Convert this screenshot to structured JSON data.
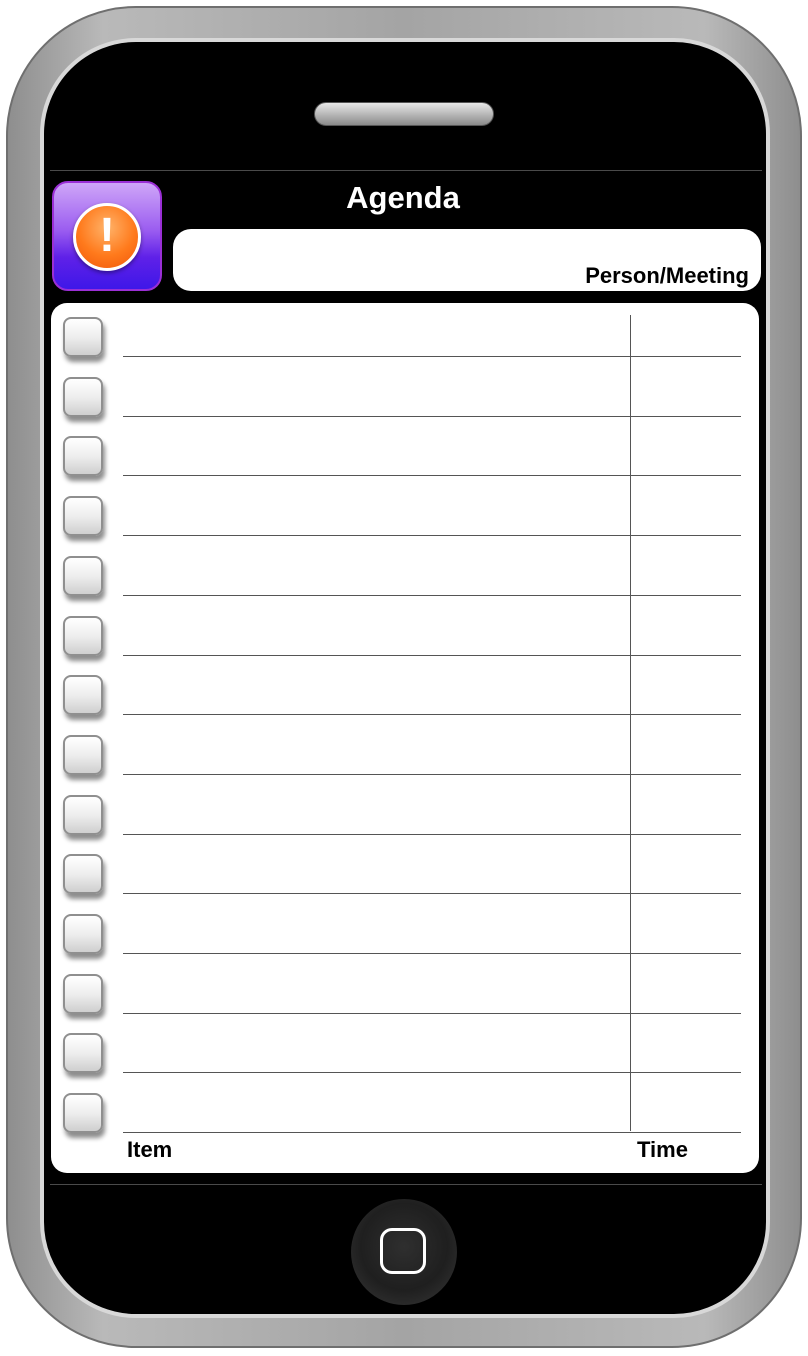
{
  "app": {
    "title": "Agenda"
  },
  "header": {
    "person_meeting_label": "Person/Meeting",
    "alert_icon_glyph": "!"
  },
  "sheet": {
    "row_count": 14,
    "columns": {
      "item_label": "Item",
      "time_label": "Time"
    }
  },
  "icons": {
    "app_icon": "alert-icon",
    "home_button": "home-button-icon"
  },
  "colors": {
    "app_icon_purple": "#5f21e8",
    "alert_orange": "#ff7a1c",
    "screen_black": "#000000",
    "phone_gray": "#a4a4a4"
  }
}
